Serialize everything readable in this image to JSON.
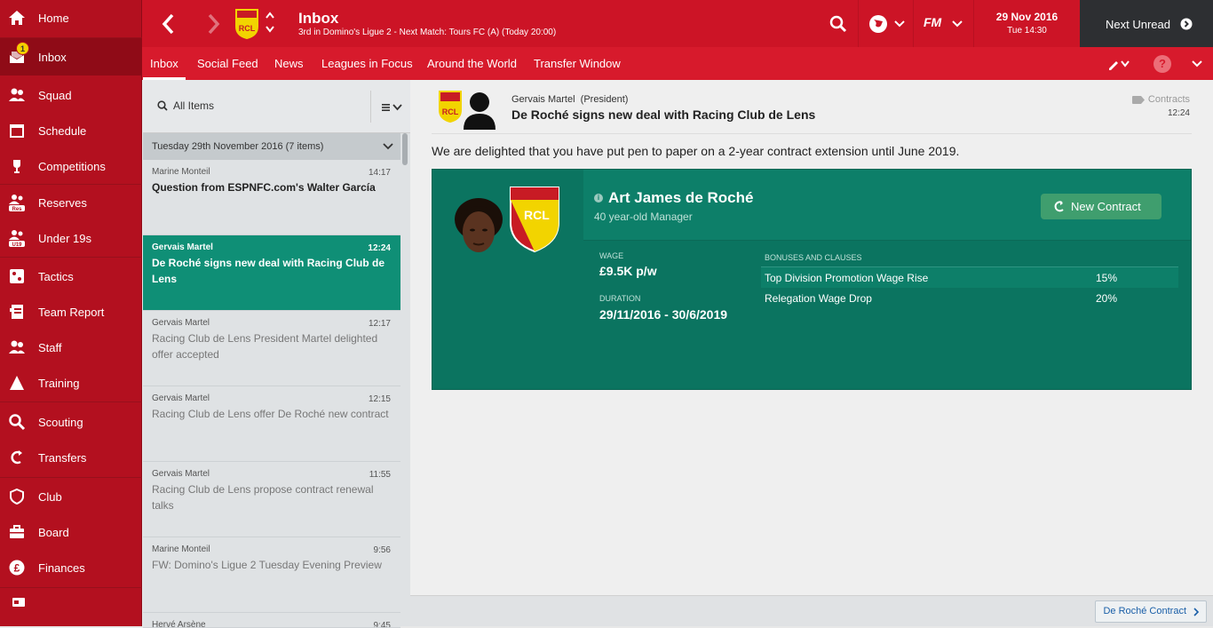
{
  "sidebar": {
    "items": [
      {
        "label": "Home",
        "icon": "home-icon"
      },
      {
        "label": "Inbox",
        "icon": "inbox-icon",
        "badge": "1"
      },
      {
        "label": "Squad",
        "icon": "squad-icon"
      },
      {
        "label": "Schedule",
        "icon": "schedule-icon"
      },
      {
        "label": "Competitions",
        "icon": "trophy-icon"
      },
      {
        "label": "Reserves",
        "icon": "reserves-icon",
        "sub": "Res"
      },
      {
        "label": "Under 19s",
        "icon": "under19-icon",
        "sub": "U19"
      },
      {
        "label": "Tactics",
        "icon": "tactics-icon"
      },
      {
        "label": "Team Report",
        "icon": "team-report-icon"
      },
      {
        "label": "Staff",
        "icon": "staff-icon"
      },
      {
        "label": "Training",
        "icon": "training-icon"
      },
      {
        "label": "Scouting",
        "icon": "scouting-icon"
      },
      {
        "label": "Transfers",
        "icon": "transfers-icon"
      },
      {
        "label": "Club",
        "icon": "club-icon"
      },
      {
        "label": "Board",
        "icon": "board-icon"
      },
      {
        "label": "Finances",
        "icon": "finances-icon"
      }
    ]
  },
  "header": {
    "title": "Inbox",
    "subtitle": "3rd in Domino's Ligue 2 - Next Match: Tours FC (A) (Today 20:00)",
    "date": "29 Nov 2016",
    "time": "Tue 14:30",
    "next_unread": "Next Unread",
    "fm_logo": "FM"
  },
  "tabs": [
    "Inbox",
    "Social Feed",
    "News",
    "Leagues in Focus",
    "Around the World",
    "Transfer Window"
  ],
  "list": {
    "filter_label": "All Items",
    "group_label": "Tuesday 29th November 2016 (7 items)",
    "messages": [
      {
        "from": "Marine Monteil",
        "time": "14:17",
        "subject": "Question from ESPNFC.com's Walter García"
      },
      {
        "from": "Gervais Martel",
        "time": "12:24",
        "subject": "De Roché signs new deal with Racing Club de Lens"
      },
      {
        "from": "Gervais Martel",
        "time": "12:17",
        "subject": "Racing Club de Lens President Martel delighted offer accepted"
      },
      {
        "from": "Gervais Martel",
        "time": "12:15",
        "subject": "Racing Club de Lens offer De Roché new contract"
      },
      {
        "from": "Gervais Martel",
        "time": "11:55",
        "subject": "Racing Club de Lens propose contract renewal talks"
      },
      {
        "from": "Marine Monteil",
        "time": "9:56",
        "subject": "FW: Domino's Ligue 2 Tuesday Evening Preview"
      },
      {
        "from": "Hervé Arsène",
        "time": "9:45",
        "subject": ""
      }
    ]
  },
  "message": {
    "sender": "Gervais Martel",
    "sender_role": "(President)",
    "subject": "De Roché signs new deal with Racing Club de Lens",
    "category": "Contracts",
    "time": "12:24",
    "body": "We are delighted that you have put pen to paper on a 2-year contract extension until June 2019.",
    "club_badge_text": "RCL",
    "card": {
      "name": "Art James de Roché",
      "desc": "40 year-old Manager",
      "button": "New Contract",
      "wage_label": "WAGE",
      "wage": "£9.5K p/w",
      "duration_label": "DURATION",
      "duration": "29/11/2016 - 30/6/2019",
      "bonuses_label": "BONUSES AND CLAUSES",
      "clauses": [
        {
          "name": "Top Division Promotion Wage Rise",
          "value": "15%"
        },
        {
          "name": "Relegation Wage Drop",
          "value": "20%"
        }
      ]
    }
  },
  "footer": {
    "link": "De Roché Contract"
  },
  "colors": {
    "sidebar": "#b3101f",
    "topbar": "#cc1426",
    "tabs": "#d71a2c",
    "selected": "#0f8f76",
    "card": "#0b7460"
  }
}
